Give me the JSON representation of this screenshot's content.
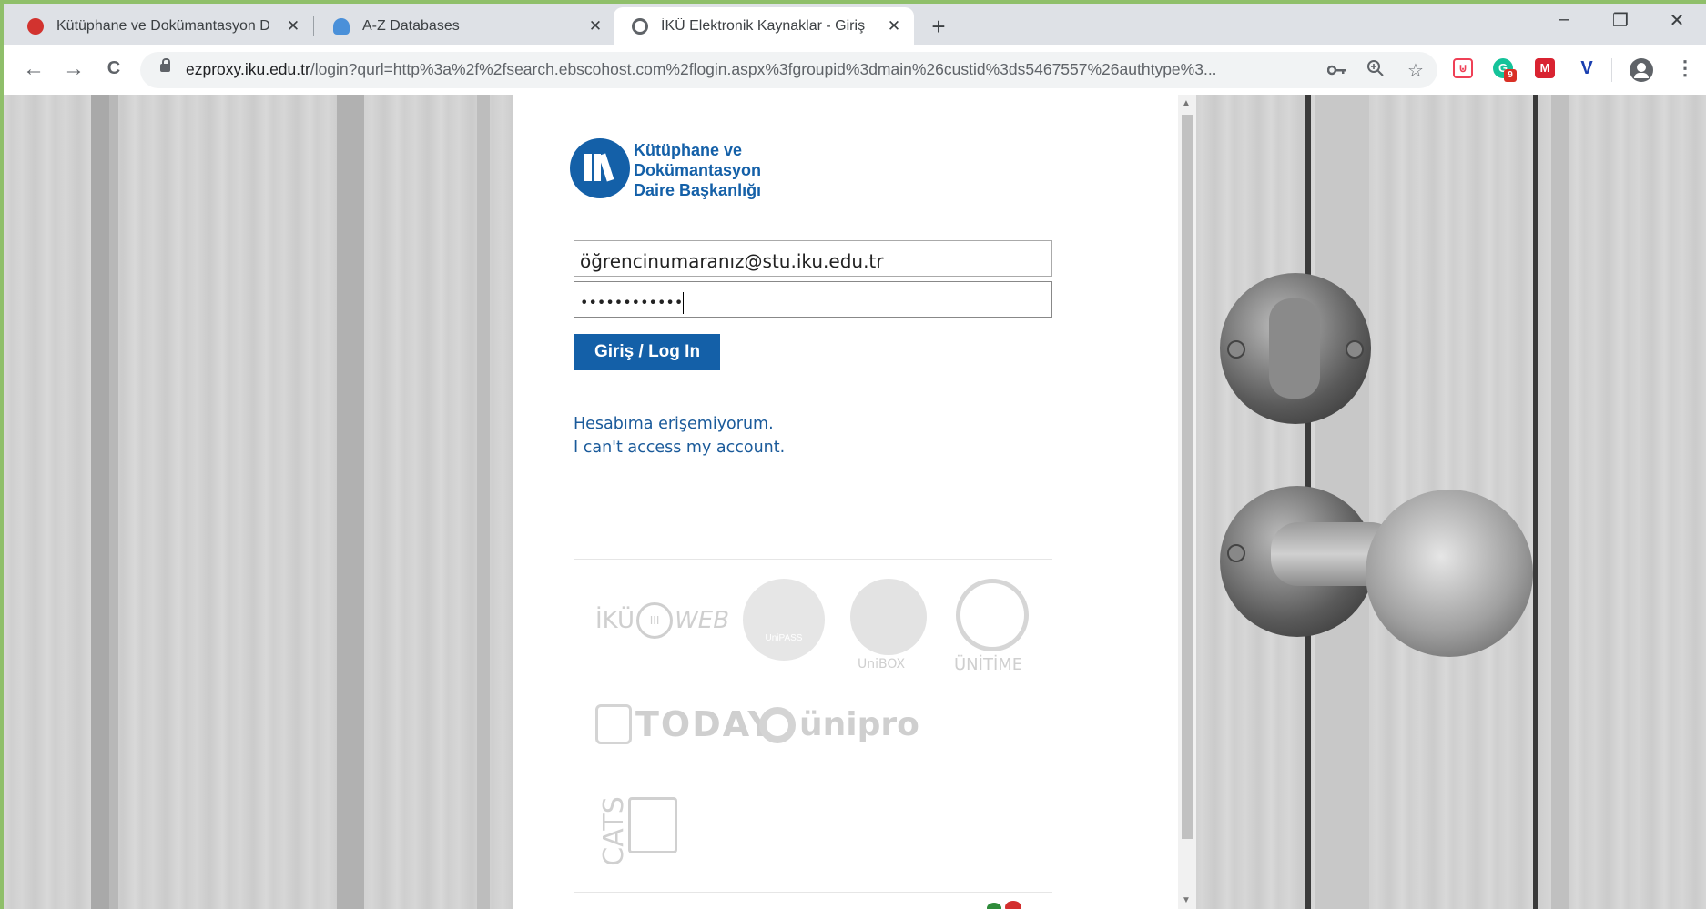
{
  "browser": {
    "tabs": [
      {
        "title": "Kütüphane ve Dokümantasyon D",
        "favicon_color": "#d2332f",
        "active": false
      },
      {
        "title": "A-Z Databases",
        "favicon_color": "#4a90d9",
        "active": false
      },
      {
        "title": "İKÜ Elektronik Kaynaklar - Giriş",
        "favicon_color": "#5f6368",
        "active": true
      }
    ],
    "close_glyph": "✕",
    "new_tab_glyph": "+",
    "window_controls": {
      "minimize": "–",
      "maximize": "❐",
      "close": "✕"
    },
    "nav": {
      "back": "←",
      "forward": "→",
      "reload": "C"
    },
    "url": {
      "host": "ezproxy.iku.edu.tr",
      "path": "/login?qurl=http%3a%2f%2fsearch.ebscohost.com%2flogin.aspx%3fgroupid%3dmain%26custid%3ds5467557%26authtype%3..."
    },
    "omnibox_icons": [
      "key-icon",
      "zoom-icon",
      "star-icon"
    ],
    "extensions": [
      {
        "name": "pocket-extension-icon",
        "color": "#ef4056",
        "glyph": "⊍"
      },
      {
        "name": "grammarly-extension-icon",
        "color": "#15c39a",
        "glyph": "G",
        "badge": "9"
      },
      {
        "name": "mendeley-extension-icon",
        "color": "#d92331",
        "glyph": "M"
      },
      {
        "name": "v-extension-icon",
        "color": "#1a3fb0",
        "glyph": "V"
      }
    ]
  },
  "login": {
    "logo_text": [
      "Kütüphane ve",
      "Dokümantasyon",
      "Daire Başkanlığı"
    ],
    "brand_color": "#1460a8",
    "email_value": "öğrencinumaranız@stu.iku.edu.tr",
    "password_mask": "••••••••••••",
    "submit_label": "Giriş / Log In",
    "link_tr": "Hesabıma erişemiyorum.",
    "link_en": "I can't access my account."
  },
  "partners": {
    "ikuweb": {
      "left": "İKÜ",
      "mid": "III",
      "right": "WEB"
    },
    "unipass": "UniPASS",
    "unibox": "UniBOX",
    "unitime": "ÜNİTİME",
    "today": "TODAY",
    "unipro": "ünipro",
    "cats": "CATS"
  }
}
